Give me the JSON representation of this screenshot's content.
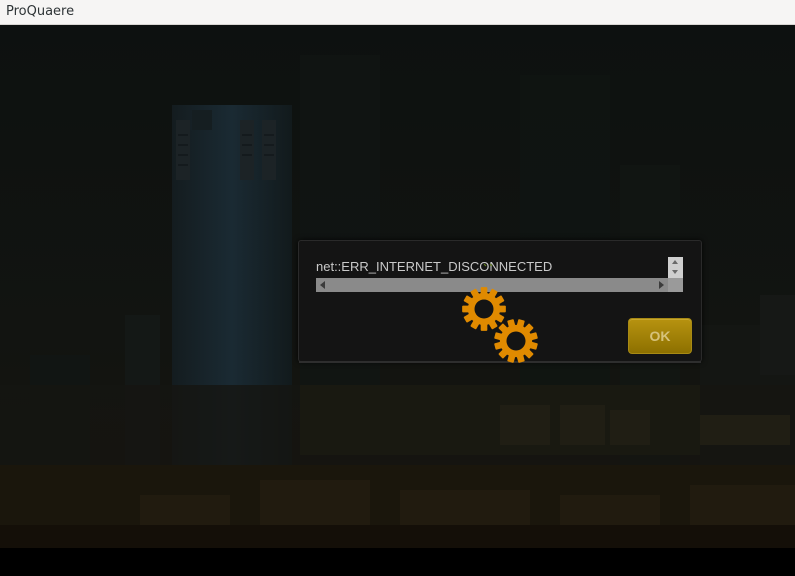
{
  "window": {
    "title": "ProQuaere"
  },
  "dialog": {
    "message": "net::ERR_INTERNET_DISCONNECTED",
    "ok_label": "OK"
  },
  "spinner": {
    "icon": "gears-loading-icon",
    "color": "#e08a00"
  },
  "colors": {
    "titlebar_bg": "#f6f5f4",
    "dialog_bg": "#141414",
    "button_gold": "#b79310",
    "message_text": "#c9c9c9"
  }
}
